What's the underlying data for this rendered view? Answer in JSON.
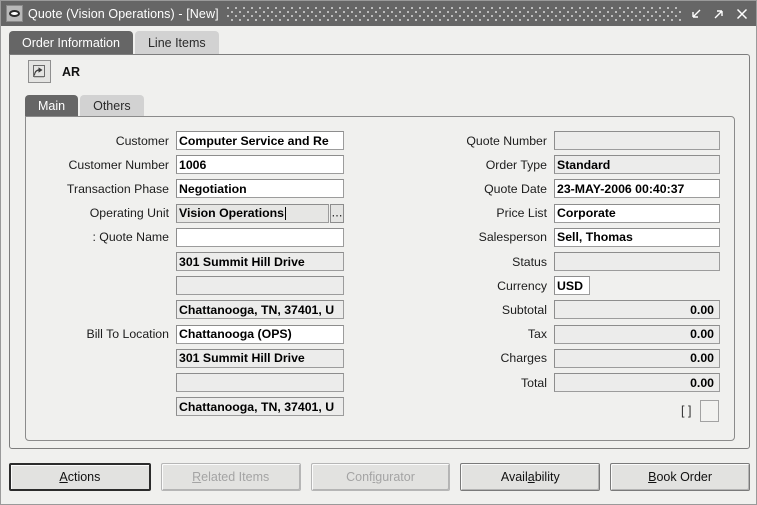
{
  "window": {
    "title": "Quote (Vision Operations) - [New]",
    "sysicon": "oracle-oval-icon",
    "controls": [
      {
        "name": "minimize",
        "glyph": "arrow-down-left-icon"
      },
      {
        "name": "maximize",
        "glyph": "arrow-up-right-icon"
      },
      {
        "name": "close",
        "glyph": "close-icon"
      }
    ]
  },
  "tabs": [
    {
      "label": "Order Information",
      "active": true
    },
    {
      "label": "Line Items",
      "active": false
    }
  ],
  "header": {
    "icon": "edit-document-icon",
    "label": "AR"
  },
  "subtabs": [
    {
      "label": "Main",
      "active": true
    },
    {
      "label": "Others",
      "active": false
    }
  ],
  "left_fields": [
    {
      "label": "Customer",
      "value": "Computer Service and Re",
      "readonly": false,
      "lov": false,
      "focused": false
    },
    {
      "label": "Customer Number",
      "value": "1006",
      "readonly": false,
      "lov": false,
      "focused": false
    },
    {
      "label": "Transaction Phase",
      "value": "Negotiation",
      "readonly": false,
      "lov": false,
      "focused": false
    },
    {
      "label": "Operating Unit",
      "value": "Vision Operations",
      "readonly": false,
      "lov": true,
      "focused": true
    },
    {
      "label": ":     Quote Name",
      "value": "",
      "readonly": false,
      "lov": false,
      "focused": false
    },
    {
      "label": "",
      "value": "301 Summit Hill Drive",
      "readonly": true,
      "lov": false,
      "focused": false
    },
    {
      "label": "",
      "value": "",
      "readonly": true,
      "lov": false,
      "focused": false
    },
    {
      "label": "",
      "value": "Chattanooga, TN, 37401, U",
      "readonly": true,
      "lov": false,
      "focused": false
    },
    {
      "label": "Bill To Location",
      "value": "Chattanooga (OPS)",
      "readonly": false,
      "lov": false,
      "focused": false
    },
    {
      "label": "",
      "value": "301 Summit Hill Drive",
      "readonly": true,
      "lov": false,
      "focused": false
    },
    {
      "label": "",
      "value": "",
      "readonly": true,
      "lov": false,
      "focused": false
    },
    {
      "label": "",
      "value": "Chattanooga, TN, 37401, U",
      "readonly": true,
      "lov": false,
      "focused": false
    }
  ],
  "right_fields": [
    {
      "label": "Quote Number",
      "value": "",
      "readonly": true,
      "numeric": false,
      "short": false
    },
    {
      "label": "Order Type",
      "value": "Standard",
      "readonly": true,
      "numeric": false,
      "short": false
    },
    {
      "label": "Quote Date",
      "value": "23-MAY-2006 00:40:37",
      "readonly": false,
      "numeric": false,
      "short": false
    },
    {
      "label": "Price List",
      "value": "Corporate",
      "readonly": false,
      "numeric": false,
      "short": false
    },
    {
      "label": "Salesperson",
      "value": "Sell, Thomas",
      "readonly": false,
      "numeric": false,
      "short": false
    },
    {
      "label": "Status",
      "value": "",
      "readonly": true,
      "numeric": false,
      "short": false
    },
    {
      "label": "Currency",
      "value": "USD",
      "readonly": false,
      "numeric": false,
      "short": true
    },
    {
      "label": "Subtotal",
      "value": "0.00",
      "readonly": true,
      "numeric": true,
      "short": false
    },
    {
      "label": "Tax",
      "value": "0.00",
      "readonly": true,
      "numeric": true,
      "short": false
    },
    {
      "label": "Charges",
      "value": "0.00",
      "readonly": true,
      "numeric": true,
      "short": false
    },
    {
      "label": "Total",
      "value": "0.00",
      "readonly": true,
      "numeric": true,
      "short": false
    }
  ],
  "dff": {
    "brackets": "[ ]",
    "button_label": ""
  },
  "buttons": [
    {
      "label": "Actions",
      "mnemonic_index": 0,
      "disabled": false,
      "default": true
    },
    {
      "label": "Related Items",
      "mnemonic_index": 0,
      "disabled": true,
      "default": false
    },
    {
      "label": "Configurator",
      "mnemonic_index": 4,
      "disabled": true,
      "default": false
    },
    {
      "label": "Availability",
      "mnemonic_index": 5,
      "disabled": false,
      "default": false
    },
    {
      "label": "Book Order",
      "mnemonic_index": 0,
      "disabled": false,
      "default": false
    }
  ],
  "colors": {
    "titlebar": "#666666",
    "panel": "#f0f0ee",
    "field_readonly": "#ececeb",
    "field_editable": "#ffffff",
    "tab_active": "#666666",
    "tab_inactive": "#d2d2d2"
  }
}
